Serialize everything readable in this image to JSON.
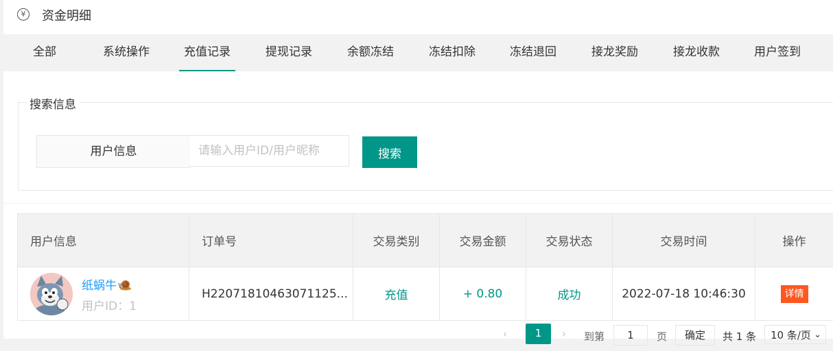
{
  "header": {
    "icon": "yen-circle-icon",
    "title": "资金明细"
  },
  "tabs": [
    {
      "label": "全部",
      "active": false
    },
    {
      "label": "系统操作",
      "active": false
    },
    {
      "label": "充值记录",
      "active": true
    },
    {
      "label": "提现记录",
      "active": false
    },
    {
      "label": "余额冻结",
      "active": false
    },
    {
      "label": "冻结扣除",
      "active": false
    },
    {
      "label": "冻结退回",
      "active": false
    },
    {
      "label": "接龙奖励",
      "active": false
    },
    {
      "label": "接龙收款",
      "active": false
    },
    {
      "label": "用户签到",
      "active": false
    }
  ],
  "search": {
    "legend": "搜索信息",
    "field_label": "用户信息",
    "placeholder": "请输入用户ID/用户昵称",
    "value": "",
    "button": "搜索"
  },
  "table": {
    "headers": [
      "用户信息",
      "订单号",
      "交易类别",
      "交易金额",
      "交易状态",
      "交易时间",
      "操作"
    ],
    "rows": [
      {
        "nickname": "纸蜗牛",
        "uid_label": "用户ID：",
        "uid": "1",
        "order_no": "H22071810463071125...",
        "type": "充值",
        "amount": "+ 0.80",
        "status": "成功",
        "time": "2022-07-18 10:46:30",
        "action": "详情"
      }
    ]
  },
  "pagination": {
    "prev": "‹",
    "current": "1",
    "next": "›",
    "goto_label": "到第",
    "goto_value": "1",
    "page_label": "页",
    "confirm": "确定",
    "total": "共 1 条",
    "page_size": "10 条/页"
  },
  "colors": {
    "accent": "#009688",
    "link": "#1e9fff",
    "danger": "#ff5722"
  }
}
